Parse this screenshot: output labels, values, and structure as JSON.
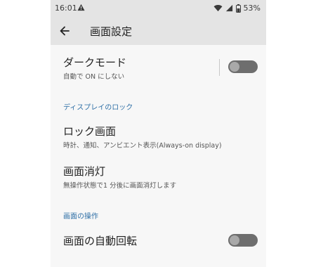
{
  "status": {
    "time": "16:01",
    "battery": "53%"
  },
  "appbar": {
    "title": "画面設定"
  },
  "dark_mode": {
    "title": "ダークモード",
    "subtitle": "自動で ON にしない",
    "enabled": false
  },
  "section_lock": {
    "header": "ディスプレイのロック"
  },
  "lock_screen": {
    "title": "ロック画面",
    "subtitle": "時計、通知、アンビエント表示(Always-on display)"
  },
  "screen_off": {
    "title": "画面消灯",
    "subtitle": "無操作状態で1 分後に画面消灯します"
  },
  "section_screen": {
    "header": "画面の操作"
  },
  "auto_rotate": {
    "title": "画面の自動回転",
    "enabled": false
  }
}
